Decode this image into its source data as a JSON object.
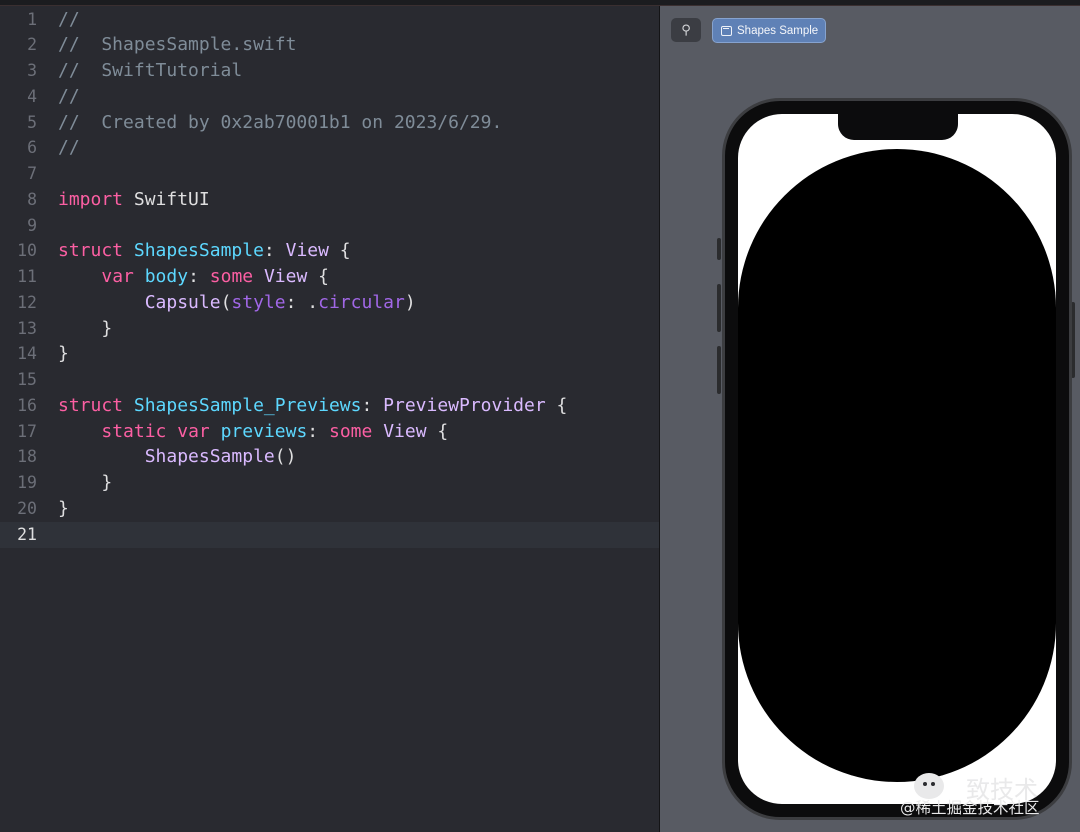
{
  "editor": {
    "current_line": "21",
    "lines": [
      {
        "no": "1",
        "tokens": [
          {
            "t": "//",
            "c": "comment"
          }
        ]
      },
      {
        "no": "2",
        "tokens": [
          {
            "t": "//  ShapesSample.swift",
            "c": "comment"
          }
        ]
      },
      {
        "no": "3",
        "tokens": [
          {
            "t": "//  SwiftTutorial",
            "c": "comment"
          }
        ]
      },
      {
        "no": "4",
        "tokens": [
          {
            "t": "//",
            "c": "comment"
          }
        ]
      },
      {
        "no": "5",
        "tokens": [
          {
            "t": "//  Created by 0x2ab70001b1 on 2023/6/29.",
            "c": "comment"
          }
        ]
      },
      {
        "no": "6",
        "tokens": [
          {
            "t": "//",
            "c": "comment"
          }
        ]
      },
      {
        "no": "7",
        "tokens": []
      },
      {
        "no": "8",
        "tokens": [
          {
            "t": "import",
            "c": "kw"
          },
          {
            "t": " SwiftUI",
            "c": "other"
          }
        ]
      },
      {
        "no": "9",
        "tokens": []
      },
      {
        "no": "10",
        "tokens": [
          {
            "t": "struct",
            "c": "kw"
          },
          {
            "t": " ",
            "c": "other"
          },
          {
            "t": "ShapesSample",
            "c": "decl"
          },
          {
            "t": ": ",
            "c": "other"
          },
          {
            "t": "View",
            "c": "type"
          },
          {
            "t": " {",
            "c": "other"
          }
        ]
      },
      {
        "no": "11",
        "tokens": [
          {
            "t": "    ",
            "c": "other"
          },
          {
            "t": "var",
            "c": "kw"
          },
          {
            "t": " ",
            "c": "other"
          },
          {
            "t": "body",
            "c": "decl"
          },
          {
            "t": ": ",
            "c": "other"
          },
          {
            "t": "some",
            "c": "kw"
          },
          {
            "t": " ",
            "c": "other"
          },
          {
            "t": "View",
            "c": "type"
          },
          {
            "t": " {",
            "c": "other"
          }
        ]
      },
      {
        "no": "12",
        "tokens": [
          {
            "t": "        ",
            "c": "other"
          },
          {
            "t": "Capsule",
            "c": "type"
          },
          {
            "t": "(",
            "c": "other"
          },
          {
            "t": "style",
            "c": "fn"
          },
          {
            "t": ": .",
            "c": "other"
          },
          {
            "t": "circular",
            "c": "fn"
          },
          {
            "t": ")",
            "c": "other"
          }
        ]
      },
      {
        "no": "13",
        "tokens": [
          {
            "t": "    }",
            "c": "other"
          }
        ]
      },
      {
        "no": "14",
        "tokens": [
          {
            "t": "}",
            "c": "other"
          }
        ]
      },
      {
        "no": "15",
        "tokens": []
      },
      {
        "no": "16",
        "tokens": [
          {
            "t": "struct",
            "c": "kw"
          },
          {
            "t": " ",
            "c": "other"
          },
          {
            "t": "ShapesSample_Previews",
            "c": "decl"
          },
          {
            "t": ": ",
            "c": "other"
          },
          {
            "t": "PreviewProvider",
            "c": "type"
          },
          {
            "t": " {",
            "c": "other"
          }
        ]
      },
      {
        "no": "17",
        "tokens": [
          {
            "t": "    ",
            "c": "other"
          },
          {
            "t": "static",
            "c": "kw"
          },
          {
            "t": " ",
            "c": "other"
          },
          {
            "t": "var",
            "c": "kw"
          },
          {
            "t": " ",
            "c": "other"
          },
          {
            "t": "previews",
            "c": "decl"
          },
          {
            "t": ": ",
            "c": "other"
          },
          {
            "t": "some",
            "c": "kw"
          },
          {
            "t": " ",
            "c": "other"
          },
          {
            "t": "View",
            "c": "type"
          },
          {
            "t": " {",
            "c": "other"
          }
        ]
      },
      {
        "no": "18",
        "tokens": [
          {
            "t": "        ",
            "c": "other"
          },
          {
            "t": "ShapesSample",
            "c": "type"
          },
          {
            "t": "()",
            "c": "other"
          }
        ]
      },
      {
        "no": "19",
        "tokens": [
          {
            "t": "    }",
            "c": "other"
          }
        ]
      },
      {
        "no": "20",
        "tokens": [
          {
            "t": "}",
            "c": "other"
          }
        ]
      },
      {
        "no": "21",
        "tokens": []
      }
    ]
  },
  "canvas": {
    "pin_icon": "pin-icon",
    "pin_glyph": "⚲",
    "preview_button_label": "Shapes Sample",
    "preview_button_icon": "window-icon"
  },
  "watermark": {
    "title": "致技术",
    "subtitle": "@稀土掘金技术社区",
    "icon": "wechat-icon"
  },
  "colors": {
    "editor_bg": "#292a30",
    "keyword": "#fc5fa3",
    "type": "#dabaff",
    "declaration": "#5dd8ff",
    "comment": "#7f8c98",
    "accent_button": "#5f81b6",
    "canvas_bg": "#585b63"
  }
}
